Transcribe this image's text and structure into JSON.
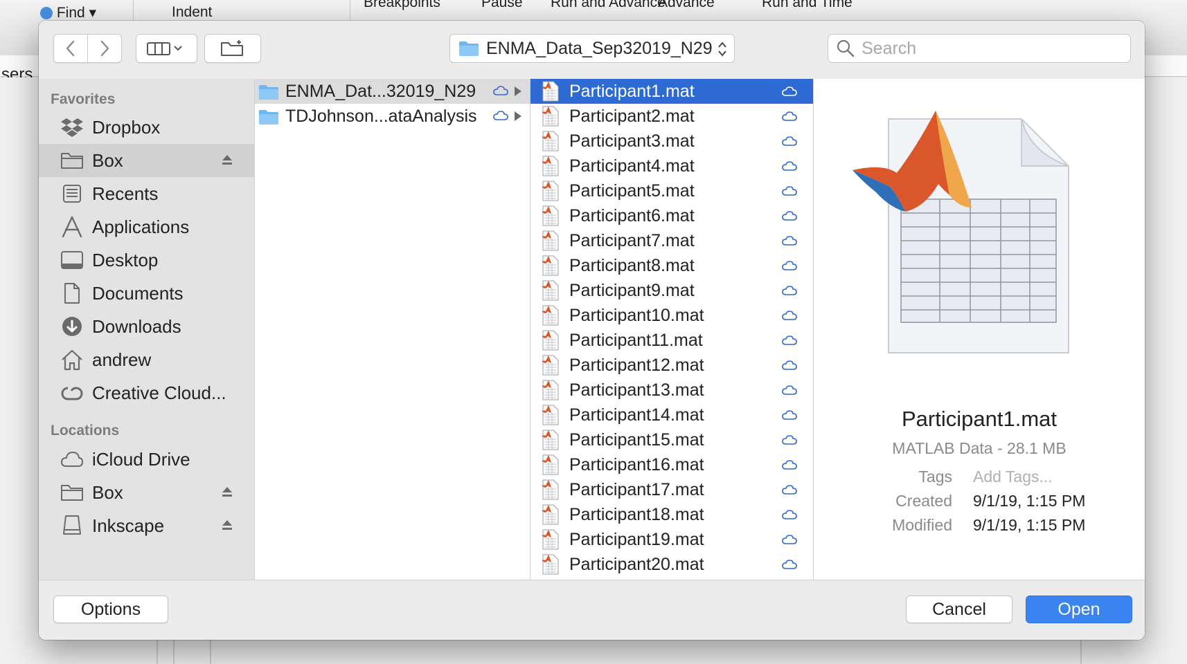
{
  "background": {
    "toolbar_items": [
      "Find",
      "Indent",
      "Breakpoints",
      "Pause",
      "Run and Advance",
      "Advance",
      "Run and Time"
    ],
    "path_fragment": "sers"
  },
  "dialog": {
    "location_popup": "ENMA_Data_Sep32019_N29",
    "search_placeholder": "Search",
    "sidebar": {
      "favorites_header": "Favorites",
      "favorites": [
        {
          "label": "Dropbox",
          "icon": "dropbox-icon"
        },
        {
          "label": "Box",
          "icon": "folder-icon",
          "eject": true,
          "selected": true
        },
        {
          "label": "Recents",
          "icon": "recents-icon"
        },
        {
          "label": "Applications",
          "icon": "applications-icon"
        },
        {
          "label": "Desktop",
          "icon": "desktop-icon"
        },
        {
          "label": "Documents",
          "icon": "documents-icon"
        },
        {
          "label": "Downloads",
          "icon": "downloads-icon"
        },
        {
          "label": "andrew",
          "icon": "home-icon"
        },
        {
          "label": "Creative Cloud...",
          "icon": "creative-cloud-icon"
        }
      ],
      "locations_header": "Locations",
      "locations": [
        {
          "label": "iCloud Drive",
          "icon": "icloud-icon"
        },
        {
          "label": "Box",
          "icon": "folder-icon",
          "eject": true
        },
        {
          "label": "Inkscape",
          "icon": "disk-icon",
          "eject": true
        }
      ]
    },
    "column1": [
      {
        "label": "ENMA_Dat...32019_N29",
        "selected": true
      },
      {
        "label": "TDJohnson...ataAnalysis",
        "selected": false
      }
    ],
    "files": [
      "Participant1.mat",
      "Participant2.mat",
      "Participant3.mat",
      "Participant4.mat",
      "Participant5.mat",
      "Participant6.mat",
      "Participant7.mat",
      "Participant8.mat",
      "Participant9.mat",
      "Participant10.mat",
      "Participant11.mat",
      "Participant12.mat",
      "Participant13.mat",
      "Participant14.mat",
      "Participant15.mat",
      "Participant16.mat",
      "Participant17.mat",
      "Participant18.mat",
      "Participant19.mat",
      "Participant20.mat"
    ],
    "selected_file_index": 0,
    "preview": {
      "name": "Participant1.mat",
      "kind": "MATLAB Data - 28.1 MB",
      "tags_label": "Tags",
      "tags_placeholder": "Add Tags...",
      "created_label": "Created",
      "created_value": "9/1/19, 1:15 PM",
      "modified_label": "Modified",
      "modified_value": "9/1/19, 1:15 PM"
    },
    "buttons": {
      "options": "Options",
      "cancel": "Cancel",
      "open": "Open"
    },
    "colors": {
      "selection_blue": "#2e6ad4",
      "primary_button": "#3a84f0",
      "folder_blue": "#6fb6f1",
      "cloud_blue": "#2e6ad4"
    }
  }
}
